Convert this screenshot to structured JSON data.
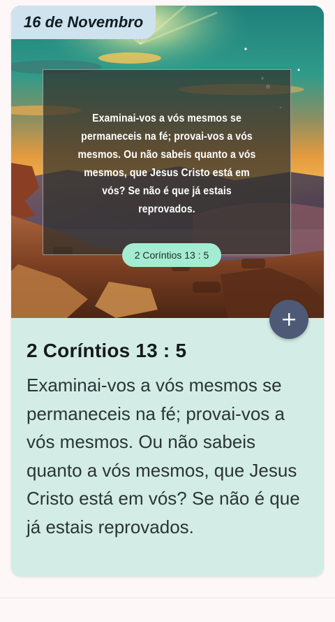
{
  "date_label": "16 de Novembro",
  "image_card": {
    "quote_text": "Examinai-vos a vós mesmos se permaneceis na fé; provai-vos a vós mesmos. Ou não sabeis quanto a vós mesmos, que Jesus Cristo está em vós? Se não é que já estais reprovados.",
    "reference_pill": "2 Coríntios 13 : 5"
  },
  "verse": {
    "reference": "2 Coríntios 13 : 5",
    "text": "Examinai-vos a vós mesmos se permaneceis na fé; provai-vos a vós mesmos. Ou não sabeis quanto a vós mesmos, que Jesus Cristo está em vós? Se não é que já estais reprovados."
  },
  "fab": {
    "icon": "plus-icon"
  },
  "colors": {
    "badge_bg": "#cfe3ee",
    "pill_bg": "#a4ecd2",
    "card_bg": "#d3ece6",
    "fab_bg": "#4e5a75",
    "page_bg": "#fdf7f8"
  }
}
